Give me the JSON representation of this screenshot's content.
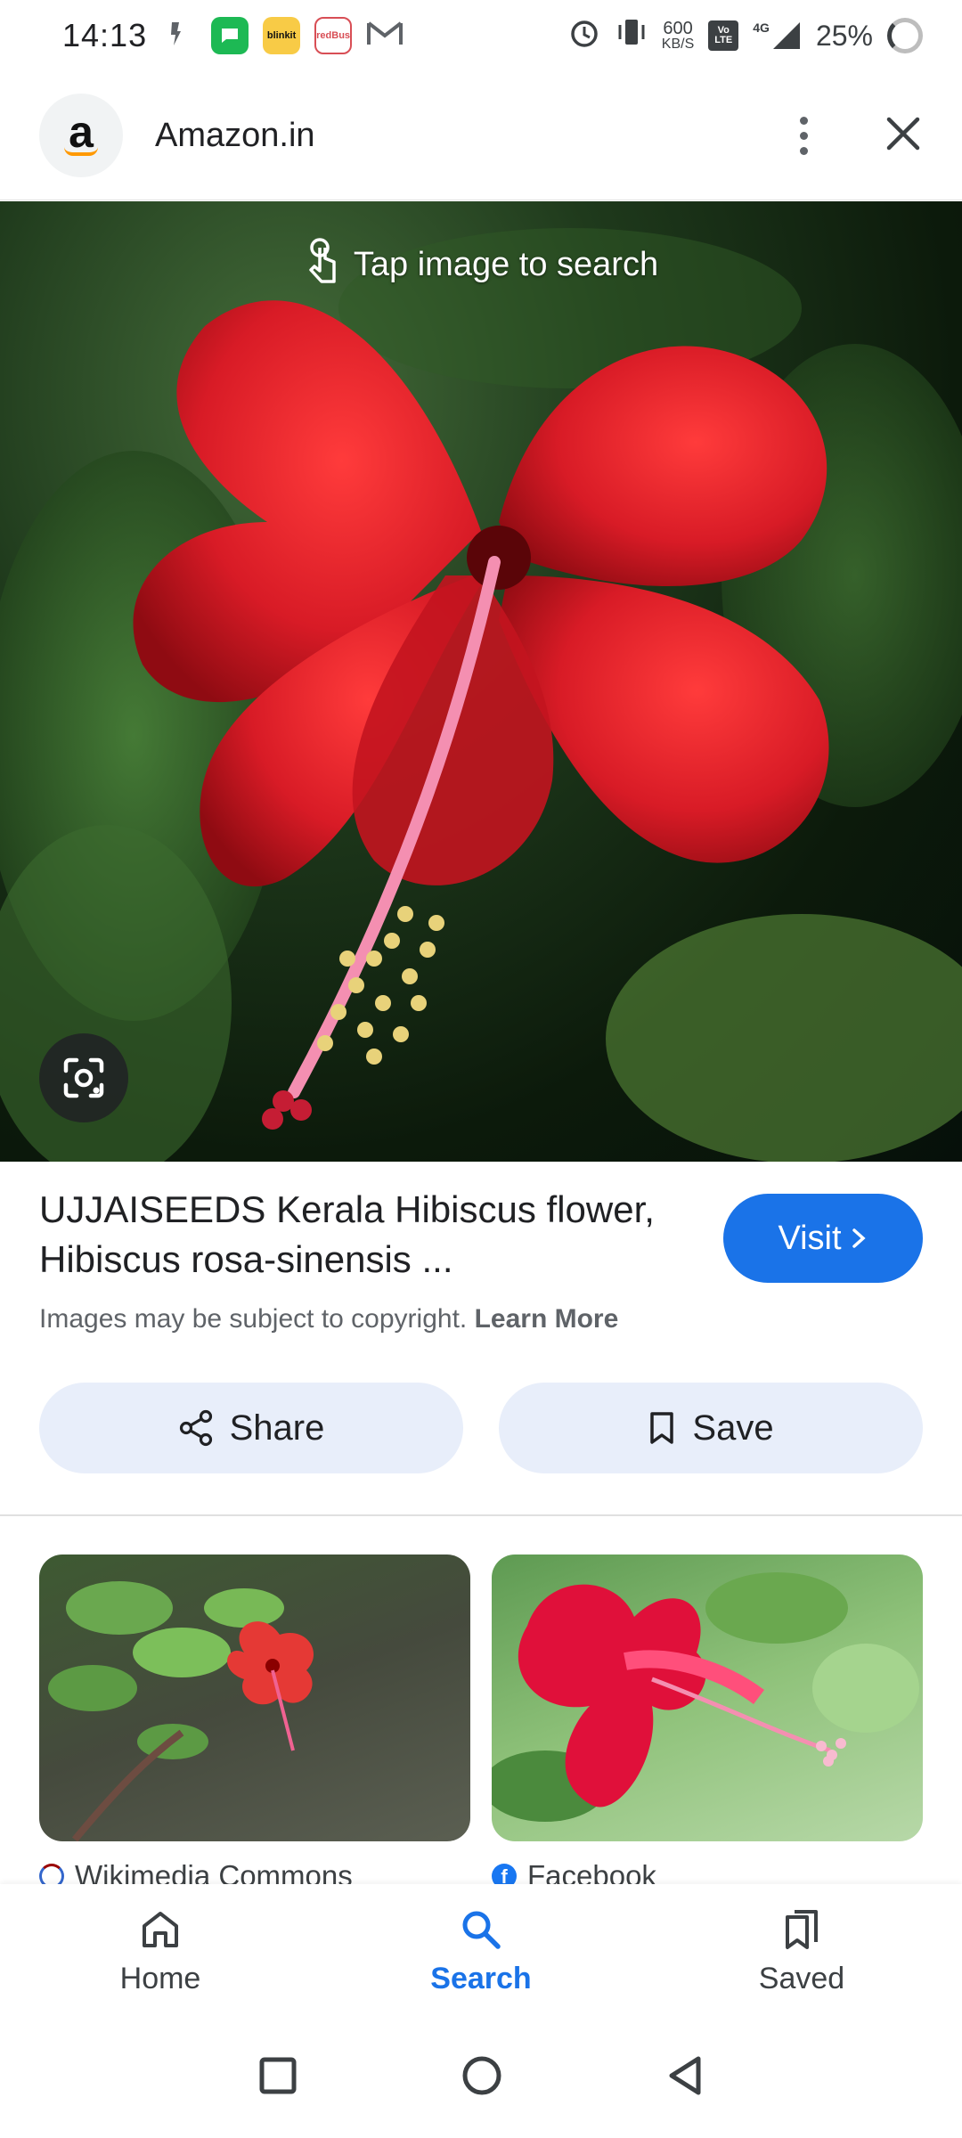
{
  "status_bar": {
    "time": "14:13",
    "net_speed_value": "600",
    "net_speed_unit": "KB/S",
    "volte": "Vo LTE",
    "network": "4G",
    "battery": "25%",
    "apps": [
      "blinkit",
      "redBus"
    ]
  },
  "header": {
    "site_name": "Amazon.in",
    "logo_letter": "a"
  },
  "hero": {
    "tap_hint": "Tap image to search"
  },
  "result": {
    "title": "UJJAISEEDS Kerala Hibiscus flower, Hibiscus rosa-sinensis ...",
    "visit_label": "Visit",
    "copyright_text": "Images may be subject to copyright.",
    "learn_more": "Learn More"
  },
  "actions": {
    "share_label": "Share",
    "save_label": "Save"
  },
  "related": [
    {
      "source": "Wikimedia Commons"
    },
    {
      "source": "Facebook"
    }
  ],
  "bottom_nav": {
    "items": [
      {
        "label": "Home",
        "icon": "home-icon"
      },
      {
        "label": "Search",
        "icon": "search-icon",
        "active": true
      },
      {
        "label": "Saved",
        "icon": "saved-icon"
      }
    ]
  },
  "colors": {
    "accent": "#1a73e8",
    "chip_bg": "#e8eefa",
    "flower_red": "#d81b26"
  }
}
